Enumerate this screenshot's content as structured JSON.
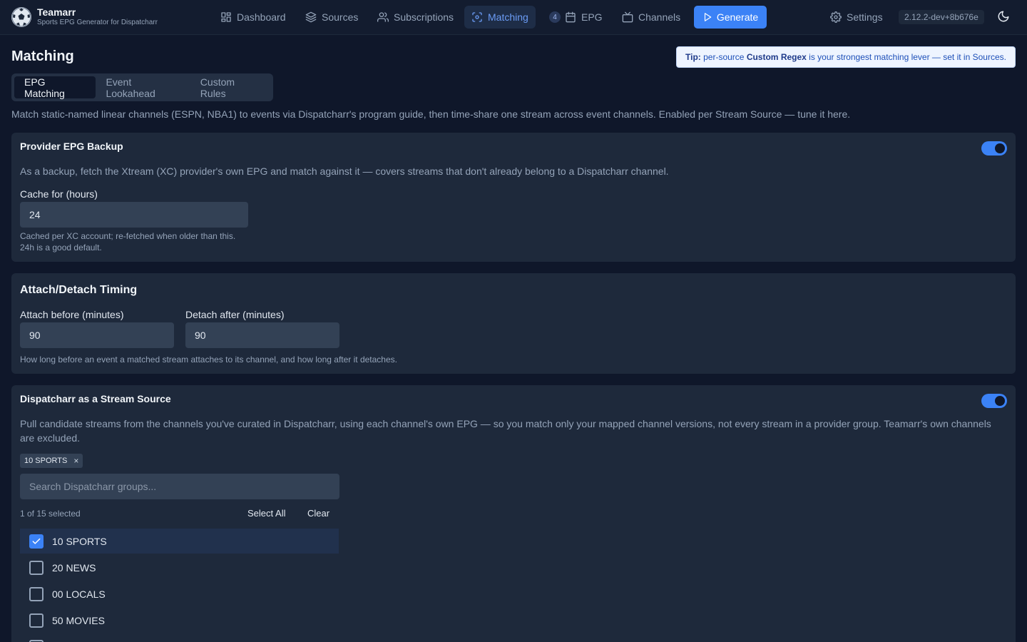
{
  "brand": {
    "name": "Teamarr",
    "subtitle": "Sports EPG Generator for Dispatcharr"
  },
  "nav": {
    "dashboard": "Dashboard",
    "sources": "Sources",
    "subscriptions": "Subscriptions",
    "matching": "Matching",
    "epg_badge": "4",
    "epg": "EPG",
    "channels": "Channels",
    "generate": "Generate",
    "settings": "Settings",
    "version": "2.12.2-dev+8b676e"
  },
  "page": {
    "title": "Matching",
    "tip_prefix": "Tip:",
    "tip_mid": " per-source ",
    "tip_bold": "Custom Regex",
    "tip_suffix": " is your strongest matching lever — set it in Sources.",
    "tabs": [
      "EPG Matching",
      "Event Lookahead",
      "Custom Rules"
    ],
    "intro": "Match static-named linear channels (ESPN, NBA1) to events via Dispatcharr's program guide, then time-share one stream across event channels. Enabled per Stream Source — tune it here."
  },
  "provider_backup": {
    "title": "Provider EPG Backup",
    "enabled": true,
    "description": "As a backup, fetch the Xtream (XC) provider's own EPG and match against it — covers streams that don't already belong to a Dispatcharr channel.",
    "cache_label": "Cache for (hours)",
    "cache_value": "24",
    "hint_line1": "Cached per XC account; re-fetched when older than this.",
    "hint_line2": "24h is a good default."
  },
  "timing": {
    "title": "Attach/Detach Timing",
    "attach_label": "Attach before (minutes)",
    "attach_value": "90",
    "detach_label": "Detach after (minutes)",
    "detach_value": "90",
    "hint": "How long before an event a matched stream attaches to its channel, and how long after it detaches."
  },
  "dispatcharr_source": {
    "title": "Dispatcharr as a Stream Source",
    "enabled": true,
    "description": "Pull candidate streams from the channels you've curated in Dispatcharr, using each channel's own EPG — so you match only your mapped channel versions, not every stream in a provider group. Teamarr's own channels are excluded.",
    "chip": "10 SPORTS",
    "chip_remove": "×",
    "search_placeholder": "Search Dispatcharr groups...",
    "selected_count": "1 of 15 selected",
    "select_all": "Select All",
    "clear": "Clear",
    "groups": [
      {
        "label": "10 SPORTS",
        "checked": true
      },
      {
        "label": "20 NEWS",
        "checked": false
      },
      {
        "label": "00 LOCALS",
        "checked": false
      },
      {
        "label": "50 MOVIES",
        "checked": false
      }
    ]
  }
}
